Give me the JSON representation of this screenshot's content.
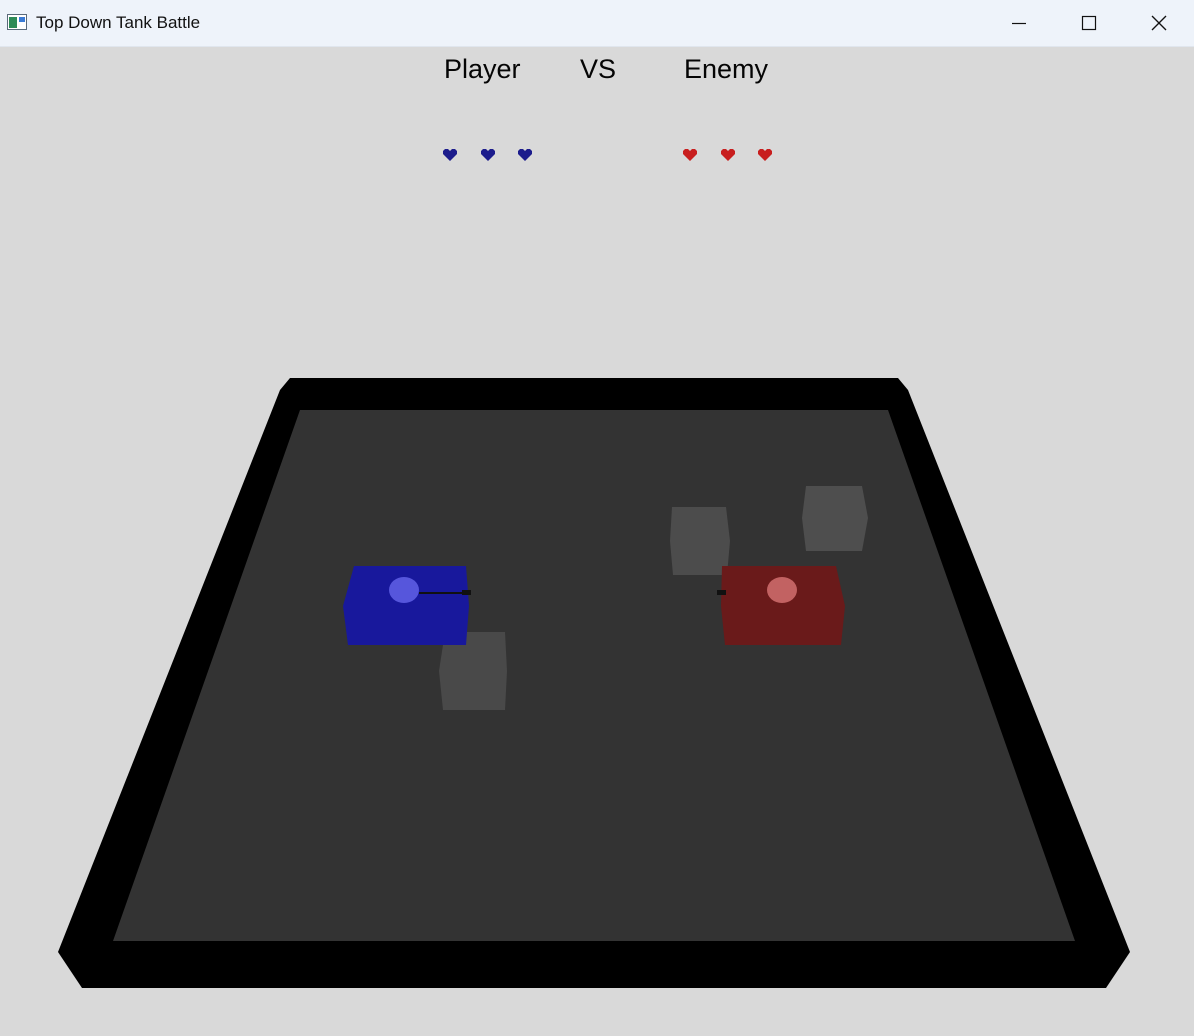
{
  "window": {
    "title": "Top Down Tank Battle"
  },
  "hud": {
    "player_label": "Player",
    "vs_label": "VS",
    "enemy_label": "Enemy",
    "player_lives": 3,
    "enemy_lives": 3
  },
  "colors": {
    "background": "#d9d9d9",
    "arena_floor": "#333333",
    "arena_wall": "#000000",
    "player": "#1a1a9e",
    "player_turret": "#5a5ae0",
    "enemy": "#6b1a1a",
    "enemy_turret": "#c06060",
    "obstacle": "#4a4a4a",
    "player_heart": "#1c1c8c",
    "enemy_heart": "#c81e1e"
  },
  "icons": {
    "app": "app-window-icon",
    "minimize": "minimize-icon",
    "maximize": "maximize-icon",
    "close": "close-icon",
    "life": "heart-icon"
  }
}
